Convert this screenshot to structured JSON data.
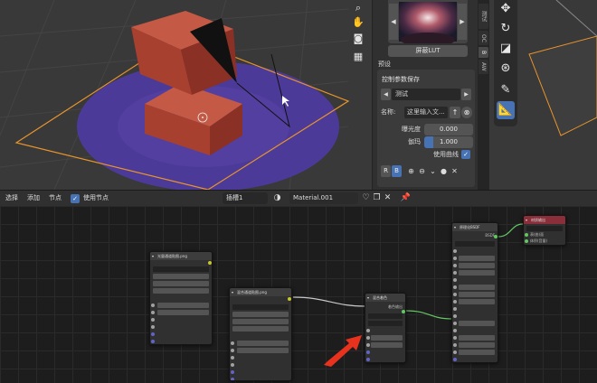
{
  "sidepanel": {
    "lut_button": "屏蔽LUT",
    "section_label": "预设",
    "subpanel_title": "控制参数保存",
    "preset_value": "测试",
    "name_label": "名称:",
    "name_placeholder": "这里输入文...",
    "exposure_label": "曝光度",
    "exposure_value": "0.000",
    "gamma_label": "伽玛",
    "gamma_value": "1.000",
    "curve_label": "使用曲线",
    "rb_r": "R",
    "rb_b": "B"
  },
  "vtabs": [
    "测试",
    "OC",
    "B",
    "AW"
  ],
  "header": {
    "menu_select": "选择",
    "menu_add": "添加",
    "menu_node": "节点",
    "use_nodes_label": "使用节点",
    "slot_value": "插槽1",
    "material_value": "Material.001"
  },
  "nodes": {
    "image1_title": "光量通道贴图.png",
    "image2_title": "混合通道贴图.png",
    "mix_title": "混合着色",
    "principled_title": "原理化BSDF",
    "output_title": "材质输出",
    "mix_output": "着色输出",
    "principled_output": "BSDF",
    "output_surface": "表(曲)面",
    "output_volume": "体积(音量)"
  },
  "colors": {
    "accent_blue": "#4772b3",
    "selection_orange": "#e8942b",
    "material_purple": "#5a3fa0",
    "cube_red": "#b54a3a",
    "output_node_header": "#8a2f3a",
    "arrow_red": "#e8321e"
  }
}
